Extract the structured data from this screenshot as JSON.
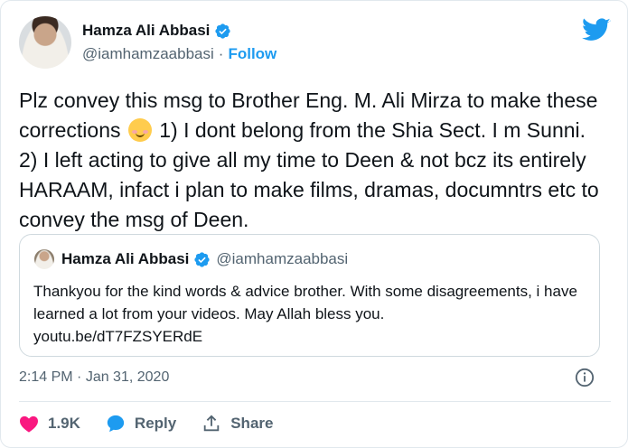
{
  "tweet": {
    "author": {
      "display_name": "Hamza Ali Abbasi",
      "handle": "@iamhamzaabbasi",
      "separator": "·",
      "follow_label": "Follow"
    },
    "text": {
      "part1": "Plz convey this msg to Brother Eng. M. Ali Mirza to make these corrections",
      "part2": " 1) I dont belong from the Shia Sect. I m Sunni. 2) I left acting to give all my time to Deen & not bcz its entirely HARAAM, infact i plan to make films, dramas, documntrs etc to convey the msg of Deen."
    },
    "quoted": {
      "display_name": "Hamza Ali Abbasi",
      "handle": "@iamhamzaabbasi",
      "text": "Thankyou for the kind words & advice brother. With some disagreements, i have learned a lot from your videos. May Allah bless you.",
      "link": "youtu.be/dT7FZSYERdE"
    },
    "meta": {
      "time": "2:14 PM",
      "separator": " · ",
      "date": "Jan 31, 2020"
    },
    "actions": {
      "like_count": "1.9K",
      "reply_label": "Reply",
      "share_label": "Share"
    }
  },
  "colors": {
    "twitter_blue": "#1d9bf0",
    "like_pink": "#f91880",
    "text_primary": "#0f1419",
    "text_secondary": "#536471",
    "border": "#cfd9de"
  },
  "icons": {
    "verified": "verified-badge-icon",
    "brand": "twitter-bird-icon",
    "like": "heart-icon",
    "reply": "speech-bubble-icon",
    "share": "share-upload-icon",
    "info": "info-circle-icon",
    "emoji": "smiling-face-with-smiling-eyes"
  }
}
